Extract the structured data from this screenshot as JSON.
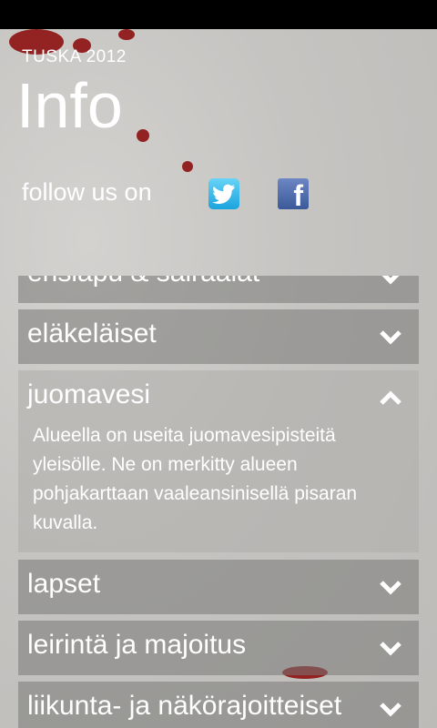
{
  "app": {
    "title": "TUSKA 2012",
    "page_title": "Info"
  },
  "social": {
    "follow_text": "follow us on",
    "icons": [
      "twitter-icon",
      "facebook-icon"
    ]
  },
  "items": [
    {
      "label": "ensiapu & sairaalat",
      "expanded": false,
      "icon": "chevron-down-icon"
    },
    {
      "label": "eläkeläiset",
      "expanded": false,
      "icon": "chevron-down-icon"
    },
    {
      "label": "juomavesi",
      "expanded": true,
      "icon": "chevron-up-icon",
      "description": "Alueella on useita juomavesipisteitä yleisölle. Ne on merkitty alueen pohjakarttaan vaaleansinisellä pisaran kuvalla."
    },
    {
      "label": "lapset",
      "expanded": false,
      "icon": "chevron-down-icon"
    },
    {
      "label": "leirintä ja majoitus",
      "expanded": false,
      "icon": "chevron-down-icon"
    },
    {
      "label": "liikunta- ja näkörajoitteiset",
      "expanded": false,
      "icon": "chevron-down-icon"
    }
  ],
  "colors": {
    "accent_blood": "#8d0f0f",
    "twitter": "#1aa4de",
    "facebook": "#3b5998"
  }
}
